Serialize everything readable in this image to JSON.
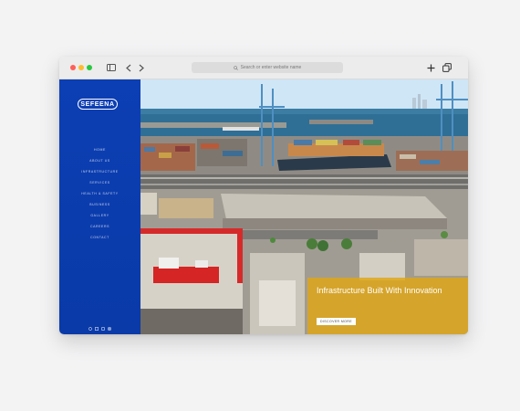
{
  "browser": {
    "address_placeholder": "Search or enter website name"
  },
  "sidebar": {
    "logo_text": "SEFEENA",
    "nav_items": [
      {
        "label": "Home"
      },
      {
        "label": "About Us"
      },
      {
        "label": "Infrastructure"
      },
      {
        "label": "Services"
      },
      {
        "label": "Health & Safety"
      },
      {
        "label": "Business"
      },
      {
        "label": "Gallery"
      },
      {
        "label": "Careers"
      },
      {
        "label": "Contact"
      }
    ],
    "social_icons": [
      "twitter-icon",
      "facebook-icon",
      "linkedin-icon",
      "instagram-icon"
    ]
  },
  "hero": {
    "headline": "Infrastructure Built With Innovation",
    "cta_label": "DISCOVER MORE"
  },
  "colors": {
    "sidebar_blue": "#0c3fb4",
    "overlay_gold": "#e1a614",
    "sky": "#cfe6f6",
    "sea": "#2f6f96"
  }
}
